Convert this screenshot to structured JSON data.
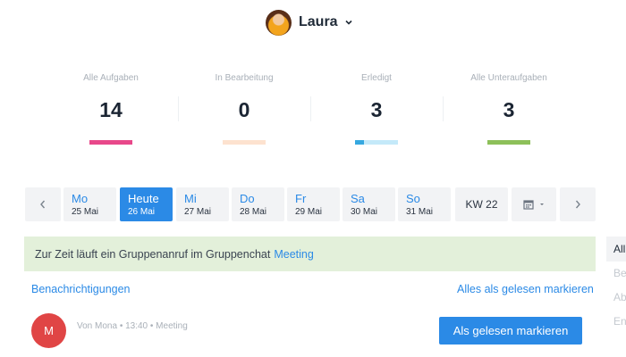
{
  "header": {
    "user_name": "Laura",
    "avatar_icon": "user-photo",
    "dropdown_icon": "chevron-down-icon"
  },
  "stats": [
    {
      "label": "Alle Aufgaben",
      "value": "14",
      "color": "#e8488a",
      "progress": 1.0
    },
    {
      "label": "In Bearbeitung",
      "value": "0",
      "color": "#fde2cf",
      "progress": 0.0
    },
    {
      "label": "Erledigt",
      "value": "3",
      "color": "#c4e9f9",
      "accent": "#35a8e0",
      "progress": 0.21
    },
    {
      "label": "Alle Unteraufgaben",
      "value": "3",
      "color": "#8dc05a",
      "progress": 1.0
    }
  ],
  "week": {
    "days": [
      {
        "name": "Mo",
        "date": "25 Mai"
      },
      {
        "name": "Heute",
        "date": "26 Mai",
        "active": true
      },
      {
        "name": "Mi",
        "date": "27 Mai"
      },
      {
        "name": "Do",
        "date": "28 Mai"
      },
      {
        "name": "Fr",
        "date": "29 Mai"
      },
      {
        "name": "Sa",
        "date": "30 Mai"
      },
      {
        "name": "So",
        "date": "31 Mai"
      }
    ],
    "week_label": "KW 22",
    "prev_icon": "chevron-left-icon",
    "next_icon": "chevron-right-icon",
    "calendar_icon": "calendar-icon"
  },
  "notice": {
    "text": "Zur Zeit läuft ein Gruppenanruf im Gruppenchat",
    "link": "Meeting",
    "background": "#e3f0da"
  },
  "side_tabs": [
    "All",
    "Be",
    "Ab",
    "En"
  ],
  "notifications": {
    "title_link": "Benachrichtigungen",
    "mark_all_link": "Alles als gelesen markieren",
    "items": [
      {
        "avatar_initial": "M",
        "avatar_color": "#e04545",
        "meta": "Von Mona • 13:40 • Meeting",
        "button": "Als gelesen markieren"
      }
    ]
  },
  "colors": {
    "accent": "#2b8ae6"
  }
}
